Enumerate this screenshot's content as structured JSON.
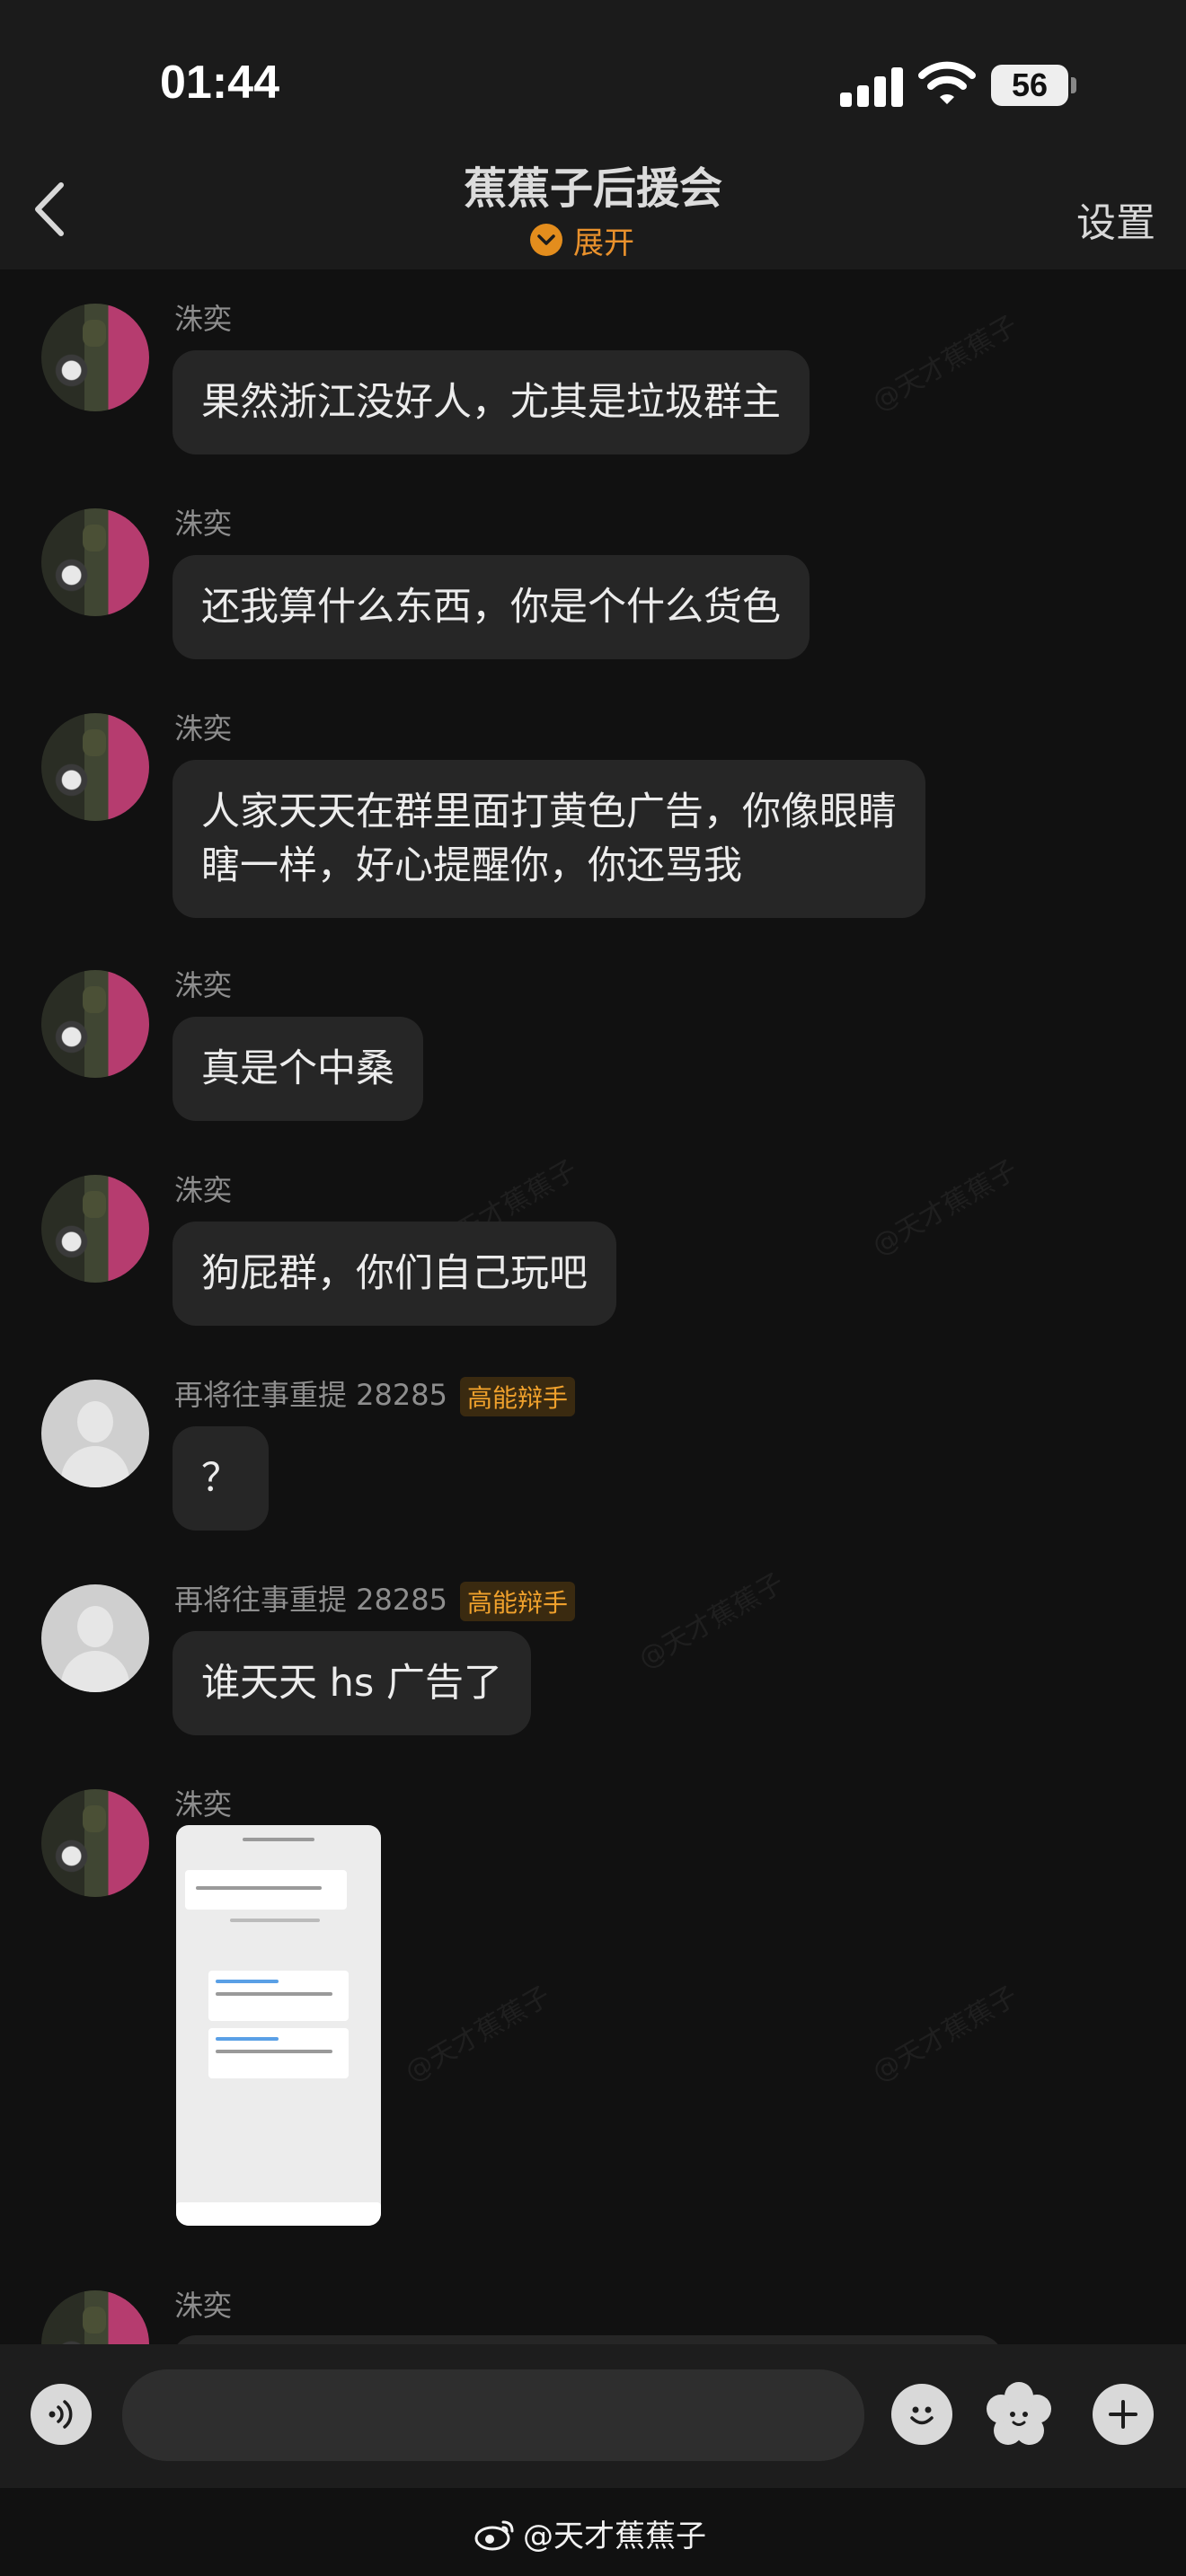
{
  "status": {
    "time": "01:44",
    "battery": "56"
  },
  "header": {
    "title": "蕉蕉子后援会",
    "expand_label": "展开",
    "settings_label": "设置"
  },
  "messages": [
    {
      "sender": "洙奕",
      "text": "果然浙江没好人，尤其是垃圾群主"
    },
    {
      "sender": "洙奕",
      "text": "还我算什么东西，你是个什么货色"
    },
    {
      "sender": "洙奕",
      "text_line1": "人家天天在群里面打黄色广告，你像眼睛",
      "text_line2": "瞎一样，好心提醒你，你还骂我"
    },
    {
      "sender": "洙奕",
      "text": "真是个中桑"
    },
    {
      "sender": "洙奕",
      "text": "狗屁群，你们自己玩吧"
    },
    {
      "sender": "再将往事重提 28285",
      "badge": "高能辩手",
      "text": "？"
    },
    {
      "sender": "再将往事重提 28285",
      "badge": "高能辩手",
      "text": "谁天天 hs 广告了"
    },
    {
      "sender": "洙奕",
      "type": "image"
    },
    {
      "sender": "洙奕"
    }
  ],
  "footer": {
    "watermark": "@天才蕉蕉子"
  },
  "watermark_bg": "@天才蕉蕉子",
  "colors": {
    "accent": "#e9912c",
    "bubble": "#262626",
    "background": "#111111",
    "badge_text": "#f0a12c"
  }
}
